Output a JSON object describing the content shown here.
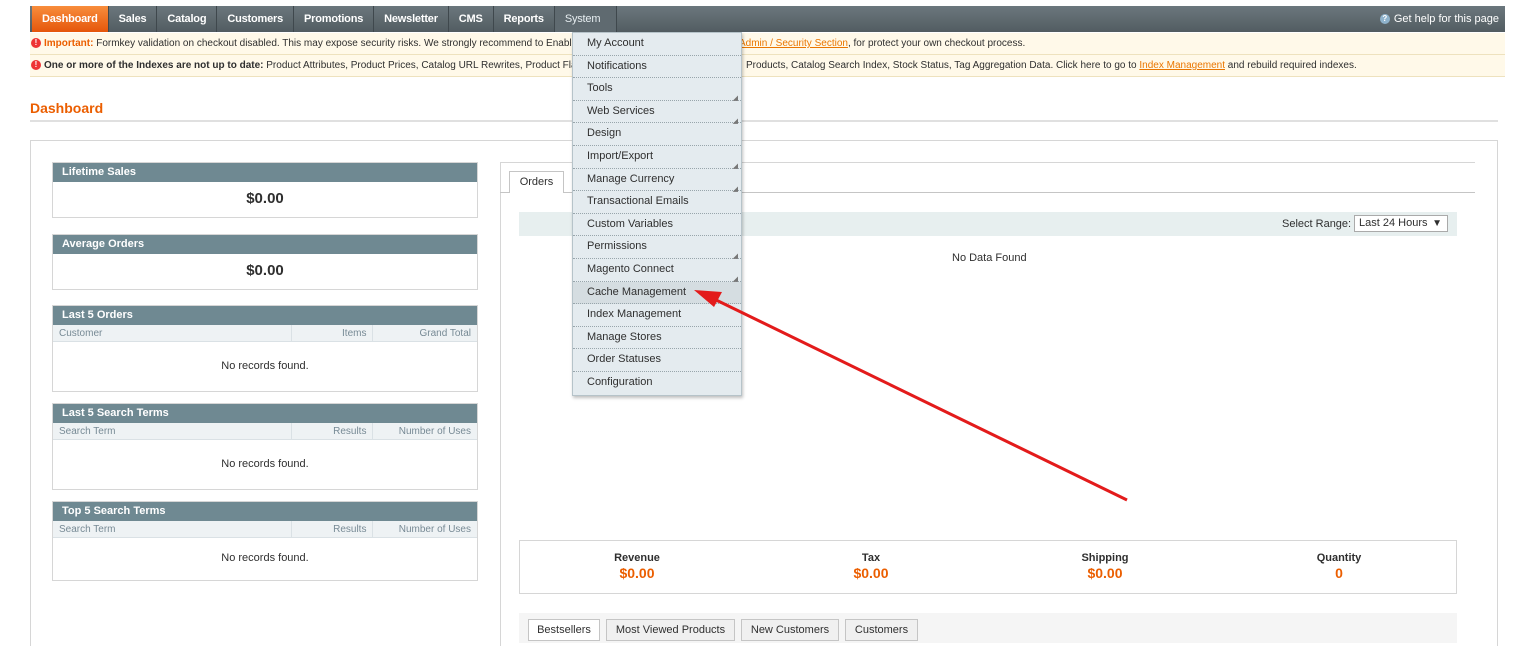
{
  "nav": {
    "items": [
      "Dashboard",
      "Sales",
      "Catalog",
      "Customers",
      "Promotions",
      "Newsletter",
      "CMS",
      "Reports",
      "System"
    ],
    "help": "Get help for this page"
  },
  "notices": {
    "n1_label": "Important:",
    "n1_text": " Formkey validation on checkout disabled. This may expose security risks. We strongly recommend to Enable",
    "n1_link": "Admin / Security Section",
    "n1_tail": ", for protect your own checkout process.",
    "n2_label": "One or more of the Indexes are not up to date:",
    "n2_text": " Product Attributes, Product Prices, Catalog URL Rewrites, Product Fla",
    "n2_mid": "Products, Catalog Search Index, Stock Status, Tag Aggregation Data. Click here to go to ",
    "n2_link": "Index Management",
    "n2_tail": " and rebuild required indexes."
  },
  "page_title": "Dashboard",
  "lifetime_sales": {
    "title": "Lifetime Sales",
    "value": "$0.00"
  },
  "average_orders": {
    "title": "Average Orders",
    "value": "$0.00"
  },
  "last_orders": {
    "title": "Last 5 Orders",
    "cols": [
      "Customer",
      "Items",
      "Grand Total"
    ],
    "empty": "No records found."
  },
  "last_search": {
    "title": "Last 5 Search Terms",
    "cols": [
      "Search Term",
      "Results",
      "Number of Uses"
    ],
    "empty": "No records found."
  },
  "top_search": {
    "title": "Top 5 Search Terms",
    "cols": [
      "Search Term",
      "Results",
      "Number of Uses"
    ],
    "empty": "No records found."
  },
  "chart_panel": {
    "tab": "Orders",
    "range_label": "Select Range:",
    "range_value": "Last 24 Hours",
    "no_data": "No Data Found"
  },
  "totals": [
    {
      "label": "Revenue",
      "value": "$0.00"
    },
    {
      "label": "Tax",
      "value": "$0.00"
    },
    {
      "label": "Shipping",
      "value": "$0.00"
    },
    {
      "label": "Quantity",
      "value": "0"
    }
  ],
  "bottom_tabs": [
    "Bestsellers",
    "Most Viewed Products",
    "New Customers",
    "Customers"
  ],
  "system_menu": [
    {
      "label": "My Account",
      "sub": false
    },
    {
      "label": "Notifications",
      "sub": false
    },
    {
      "label": "Tools",
      "sub": true
    },
    {
      "label": "Web Services",
      "sub": true
    },
    {
      "label": "Design",
      "sub": false
    },
    {
      "label": "Import/Export",
      "sub": true
    },
    {
      "label": "Manage Currency",
      "sub": true
    },
    {
      "label": "Transactional Emails",
      "sub": false
    },
    {
      "label": "Custom Variables",
      "sub": false
    },
    {
      "label": "Permissions",
      "sub": true
    },
    {
      "label": "Magento Connect",
      "sub": true
    },
    {
      "label": "Cache Management",
      "sub": false
    },
    {
      "label": "Index Management",
      "sub": false
    },
    {
      "label": "Manage Stores",
      "sub": false
    },
    {
      "label": "Order Statuses",
      "sub": false
    },
    {
      "label": "Configuration",
      "sub": false
    }
  ],
  "colors": {
    "accent": "#eb5e00",
    "nav": "#525c61",
    "box_head": "#6f8992",
    "arrow": "#e31b1b"
  }
}
